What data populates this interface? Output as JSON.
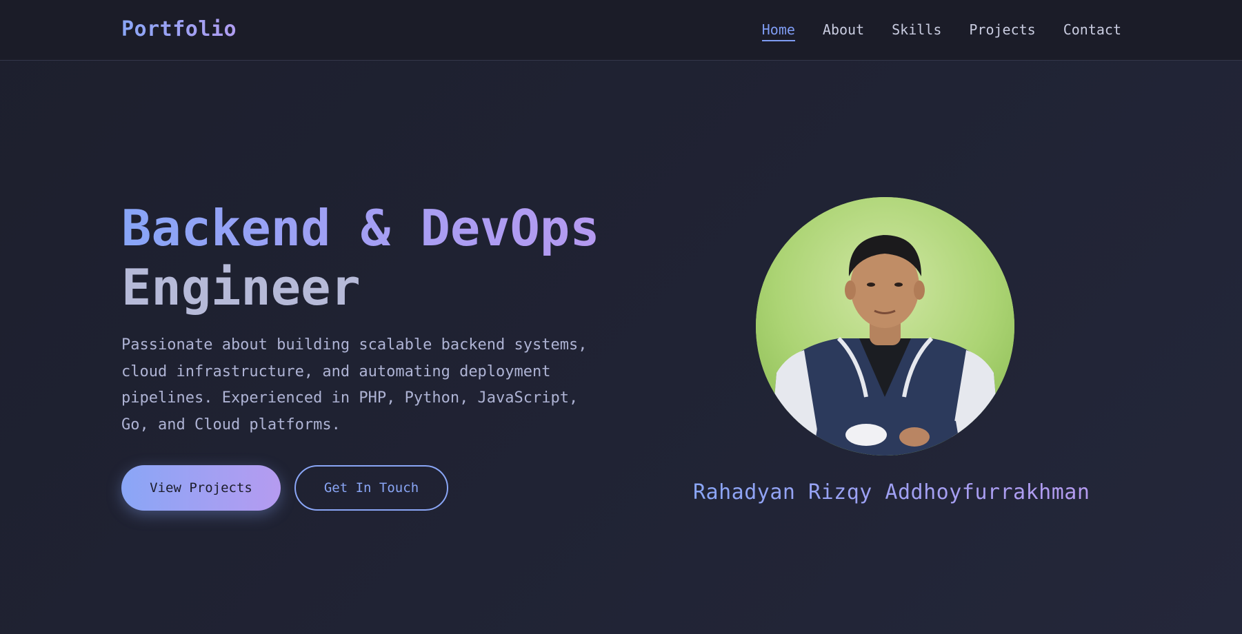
{
  "nav": {
    "brand": "Portfolio",
    "links": [
      {
        "label": "Home",
        "active": true
      },
      {
        "label": "About",
        "active": false
      },
      {
        "label": "Skills",
        "active": false
      },
      {
        "label": "Projects",
        "active": false
      },
      {
        "label": "Contact",
        "active": false
      }
    ]
  },
  "hero": {
    "title_line1": "Backend & DevOps",
    "title_line2": "Engineer",
    "description": "Passionate about building scalable backend systems, cloud infrastructure, and automating deployment pipelines. Experienced in PHP, Python, JavaScript, Go, and Cloud platforms.",
    "primary_button": "View Projects",
    "secondary_button": "Get In Touch"
  },
  "profile": {
    "name": "Rahadyan Rizqy Addhoyfurrakhman",
    "photo": "profile-photo"
  },
  "colors": {
    "accent_start": "#8aa6f6",
    "accent_end": "#b59bf0",
    "background": "#1d1f2d",
    "navbar": "#1b1c28"
  }
}
